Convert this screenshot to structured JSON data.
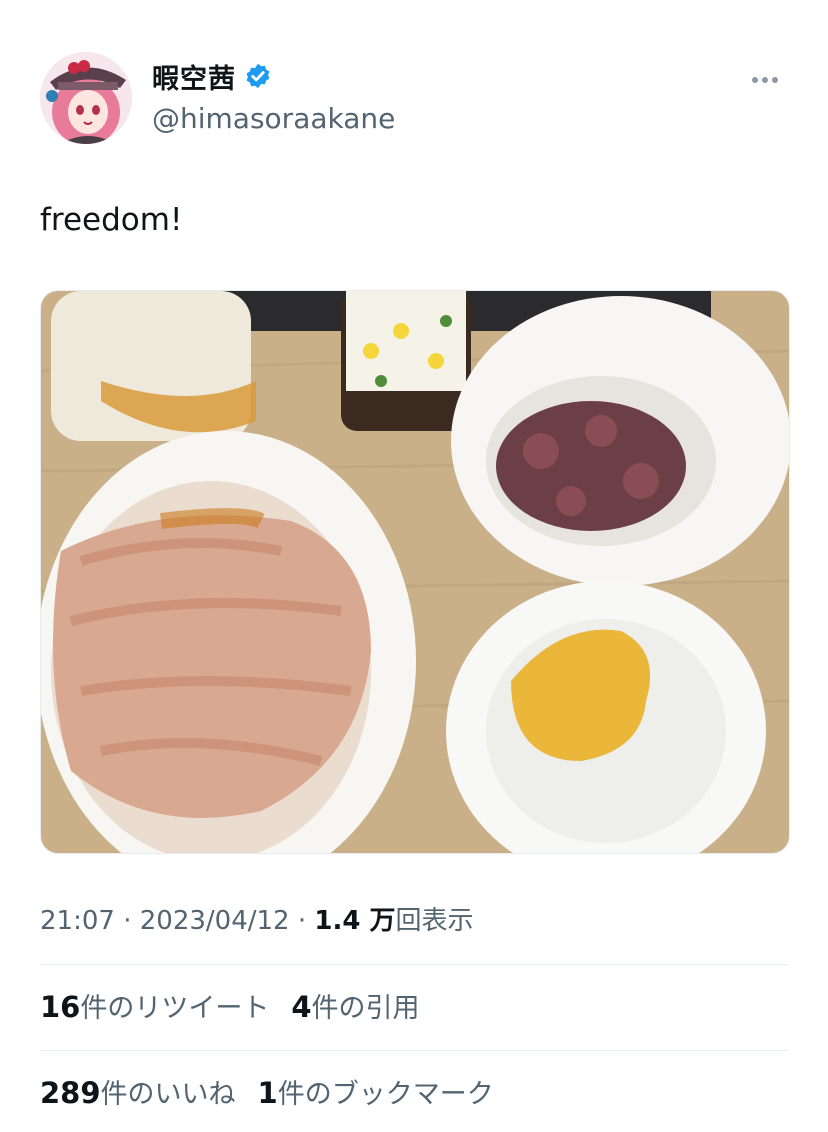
{
  "author": {
    "display_name": "暇空茜",
    "handle": "@himasoraakane",
    "verified": true
  },
  "tweet": {
    "text": "freedom!",
    "time": "21:07",
    "separator": "·",
    "date": "2023/04/12",
    "views_count": "1.4 万",
    "views_label": "回表示"
  },
  "stats": {
    "retweets_count": "16",
    "retweets_label": "件のリツイート",
    "quotes_count": "4",
    "quotes_label": "件の引用",
    "likes_count": "289",
    "likes_label": "件のいいね",
    "bookmarks_count": "1",
    "bookmarks_label": "件のブックマーク"
  },
  "colors": {
    "verified_badge": "#1d9bf0",
    "secondary_text": "#536471",
    "primary_text": "#0f1419",
    "divider": "#e6ecf0"
  },
  "icons": {
    "verified": "verified-badge-icon",
    "more": "more-options-icon"
  }
}
